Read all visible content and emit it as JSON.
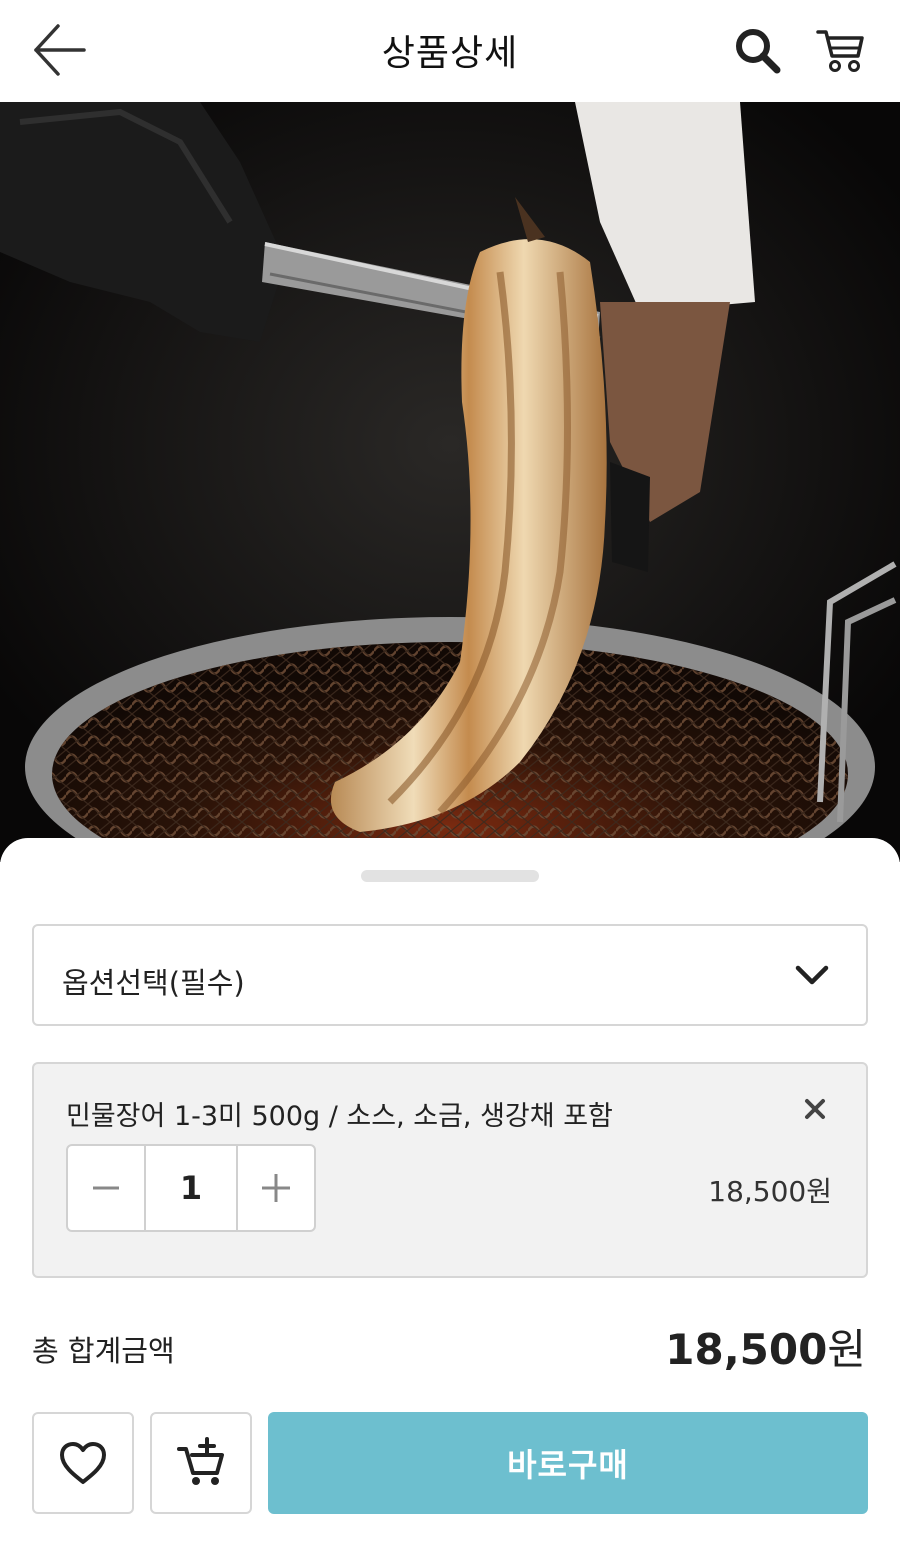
{
  "header": {
    "title": "상품상세",
    "back_icon": "arrow-left-icon",
    "search_icon": "search-icon",
    "cart_icon": "cart-icon"
  },
  "product": {
    "image_subject": "grilled-eel-on-charcoal-grill"
  },
  "options": {
    "select_label": "옵션선택(필수)",
    "selected": {
      "name": "민물장어 1-3미 500g / 소스, 소금, 생강채 포함",
      "quantity": "1",
      "price": "18,500원"
    }
  },
  "summary": {
    "total_label": "총 합계금액",
    "total_amount": "18,500",
    "total_unit": "원"
  },
  "actions": {
    "wishlist_icon": "heart-icon",
    "add_cart_icon": "cart-plus-icon",
    "buy_label": "바로구매"
  },
  "colors": {
    "accent": "#6dbfcf",
    "border": "#d6d6d6",
    "item_bg": "#f2f2f2"
  }
}
